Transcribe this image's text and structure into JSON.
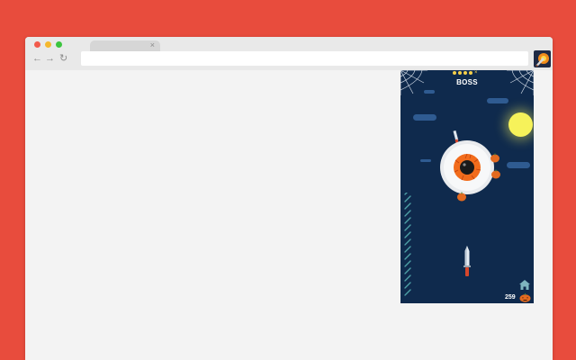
{
  "browser": {
    "tab_close": "×",
    "back_glyph": "←",
    "forward_glyph": "→",
    "reload_glyph": "↻",
    "address_value": ""
  },
  "icons": {
    "extension": "knife-hit-extension-icon",
    "home": "home-icon",
    "pumpkin": "pumpkin-icon",
    "knife": "knife-icon"
  },
  "game": {
    "stage_label": "BOSS",
    "stage_progress": {
      "completed": 4,
      "total": 5,
      "boss_marker": "×"
    },
    "score": "259",
    "knives_remaining": 15
  },
  "colors": {
    "page_background": "#e84c3d",
    "game_background": "#0f2a4d",
    "cloud": "#2f5b91",
    "moon": "#f6f25a",
    "eye_iris": "#f26c1c",
    "pumpkin": "#e36a20",
    "stripes": "#4da0a6"
  }
}
